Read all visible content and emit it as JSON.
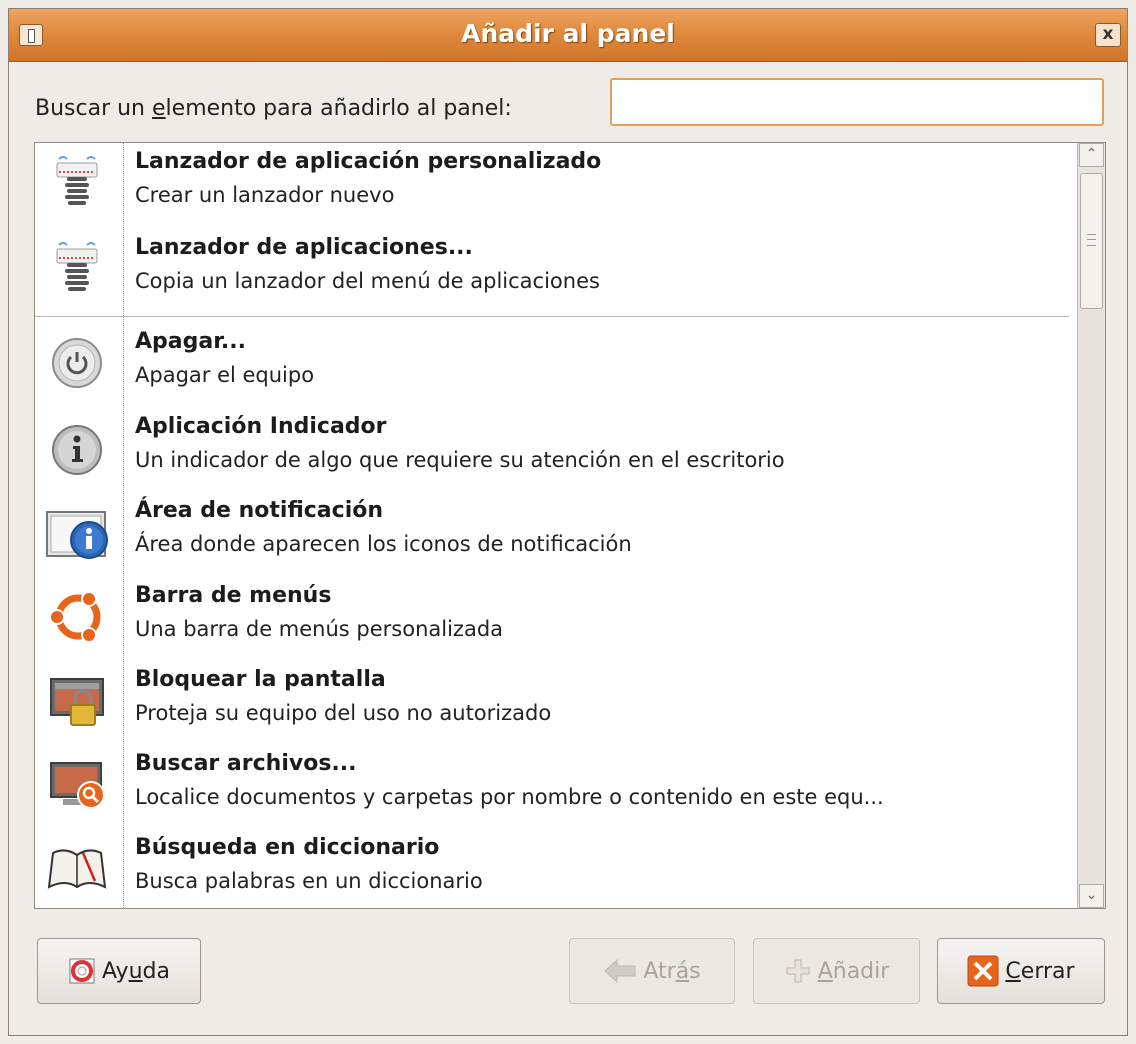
{
  "window": {
    "title": "Añadir al panel",
    "close_glyph": "x"
  },
  "search": {
    "label_before": "Buscar un ",
    "label_mnemonic": "e",
    "label_after": "lemento para añadirlo al panel:",
    "value": "",
    "placeholder": ""
  },
  "items": [
    {
      "name": "Lanzador de aplicación personalizado",
      "desc": "Crear un lanzador nuevo",
      "icon": "launcher-icon"
    },
    {
      "name": "Lanzador de aplicaciones...",
      "desc": "Copia un lanzador del menú de aplicaciones",
      "icon": "launcher-icon"
    },
    {
      "name": "Apagar...",
      "desc": "Apagar el equipo",
      "icon": "power-icon"
    },
    {
      "name": "Aplicación Indicador",
      "desc": "Un indicador de algo que requiere su atención en el escritorio",
      "icon": "indicator-icon"
    },
    {
      "name": "Área de notificación",
      "desc": "Área donde aparecen los iconos de notificación",
      "icon": "notification-area-icon"
    },
    {
      "name": "Barra de menús",
      "desc": "Una barra de menús personalizada",
      "icon": "ubuntu-logo-icon"
    },
    {
      "name": "Bloquear la pantalla",
      "desc": "Proteja su equipo del uso no autorizado",
      "icon": "lock-screen-icon"
    },
    {
      "name": "Buscar archivos...",
      "desc": "Localice documentos y carpetas por nombre o contenido en este equ...",
      "icon": "search-files-icon"
    },
    {
      "name": "Búsqueda en diccionario",
      "desc": "Busca palabras en un diccionario",
      "icon": "dictionary-icon"
    }
  ],
  "buttons": {
    "help": {
      "before": "Ay",
      "mnemonic": "u",
      "after": "da"
    },
    "back": {
      "before": "Atr",
      "mnemonic": "á",
      "after": "s"
    },
    "add": {
      "before": "",
      "mnemonic": "A",
      "after": "ñadir"
    },
    "close": {
      "before": "",
      "mnemonic": "C",
      "after": "errar"
    }
  },
  "scrollbar": {
    "up_glyph": "⌃",
    "down_glyph": "⌄"
  },
  "colors": {
    "title_bar": "#e08a3e",
    "focus_border": "#e3a15e",
    "close_icon_bg": "#e8641b"
  }
}
